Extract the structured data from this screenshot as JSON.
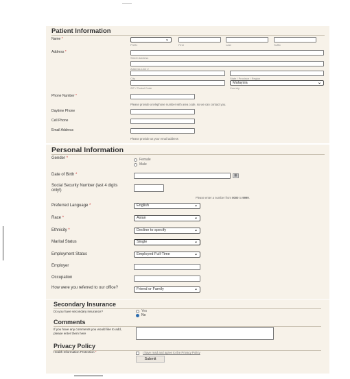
{
  "patient": {
    "title": "Patient Information",
    "name_label": "Name",
    "name_sub": {
      "prefix": "Prefix",
      "first": "First",
      "last": "Last",
      "suffix": "Suffix"
    },
    "address_label": "Address",
    "street": "Street Address",
    "line2": "Address Line 2",
    "city": "City",
    "state": "State / Province / Region",
    "zip": "ZIP / Postal Code",
    "country_label": "Country",
    "country_value": "Malaysia",
    "phone_label": "Phone Number",
    "phone_hint": "Please provide a telephone number with area code, so we can contact you.",
    "daytime_label": "Daytime Phone",
    "cell_label": "Cell Phone",
    "email_label": "Email Address",
    "email_hint": "Please provide us your email address"
  },
  "personal": {
    "title": "Personal Information",
    "gender_label": "Gender",
    "gender_options": [
      "Female",
      "Male"
    ],
    "dob_label": "Date of Birth",
    "ssn_label": "Social Security Number (last 4 digits only!)",
    "ssn_hint_pre": "Please enter a number from ",
    "ssn_from": "0000",
    "ssn_to_word": " to ",
    "ssn_to": "9999",
    "ssn_dot": ".",
    "language_label": "Preferred Language",
    "language_value": "English",
    "race_label": "Race",
    "race_value": "Asian",
    "ethnicity_label": "Ethnicity",
    "ethnicity_value": "Decline to specify",
    "marital_label": "Marital Status",
    "marital_value": "Single",
    "employment_label": "Employment Status",
    "employment_value": "Employed Full-Time",
    "employer_label": "Employer",
    "occupation_label": "Occupation",
    "referral_label": "How were you referred to our office?",
    "referral_value": "Friend or Family"
  },
  "secondary": {
    "title": "Secondary Insurance",
    "question": "Do you have secondary insurance?",
    "options": [
      "Yes",
      "No"
    ],
    "selected": "No"
  },
  "comments": {
    "title": "Comments",
    "question": "If you have any comments you would like to add, please enter them here"
  },
  "privacy": {
    "title": "Privacy Policy",
    "label": "Health Information Protection",
    "agree_text": "I have read and agree to the Privacy Policy"
  },
  "submit_label": "Submit",
  "required_mark": "*",
  "colors": {
    "panel": "#f7f2e9",
    "radio_selected": "#2b6cb0"
  }
}
